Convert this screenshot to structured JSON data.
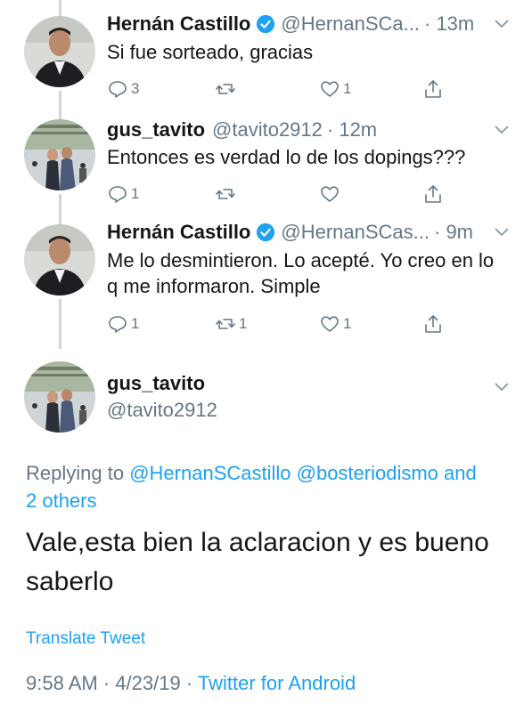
{
  "tweets": [
    {
      "name": "Hernán Castillo",
      "verified": true,
      "handle": "@HernanSCa...",
      "time": "· 13m",
      "text": "Si fue sorteado, gracias",
      "reply_count": "3",
      "retweet_count": "",
      "like_count": "1"
    },
    {
      "name": "gus_tavito",
      "verified": false,
      "handle": "@tavito2912",
      "time": "· 12m",
      "text": "Entonces es verdad lo de los dopings???",
      "reply_count": "1",
      "retweet_count": "",
      "like_count": ""
    },
    {
      "name": "Hernán Castillo",
      "verified": true,
      "handle": "@HernanSCas...",
      "time": "· 9m",
      "text": "Me lo desmintieron. Lo acepté. Yo creo en lo q me informaron. Simple",
      "reply_count": "1",
      "retweet_count": "1",
      "like_count": "1"
    }
  ],
  "main_tweet": {
    "name": "gus_tavito",
    "handle": "@tavito2912",
    "replying_prefix": "Replying to",
    "replying_mention1": "@HernanSCastillo",
    "replying_mention2": "@bosteriodismo",
    "replying_and": "and",
    "replying_others": "2 others",
    "text": "Vale,esta bien la aclaracion y es bueno saberlo",
    "translate": "Translate Tweet",
    "time": "9:58 AM",
    "date": "4/23/19",
    "separator": "·",
    "source": "Twitter for Android"
  },
  "icons": {
    "reply": "reply-icon",
    "retweet": "retweet-icon",
    "like": "heart-icon",
    "share": "share-icon",
    "verified": "verified-badge-icon",
    "more": "chevron-down-icon"
  },
  "colors": {
    "link": "#1da1f2",
    "secondary": "#657786",
    "verified": "#1da1f2"
  }
}
